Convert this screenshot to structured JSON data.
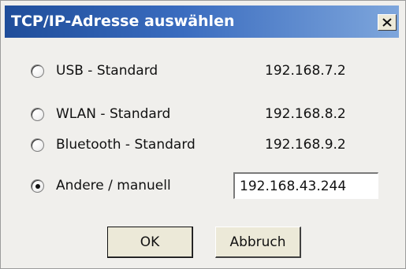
{
  "window": {
    "title": "TCP/IP-Adresse auswählen",
    "close_icon": "close-icon"
  },
  "options": [
    {
      "label": "USB - Standard",
      "ip": "192.168.7.2",
      "selected": false
    },
    {
      "label": "WLAN - Standard",
      "ip": "192.168.8.2",
      "selected": false
    },
    {
      "label": "Bluetooth - Standard",
      "ip": "192.168.9.2",
      "selected": false
    },
    {
      "label": "Andere / manuell",
      "ip": "192.168.43.244",
      "selected": true
    }
  ],
  "buttons": {
    "ok_label": "OK",
    "cancel_label": "Abbruch"
  },
  "colors": {
    "titlebar_start": "#1f4d9a",
    "titlebar_end": "#7ea6dc",
    "dialog_bg": "#f0efec"
  }
}
